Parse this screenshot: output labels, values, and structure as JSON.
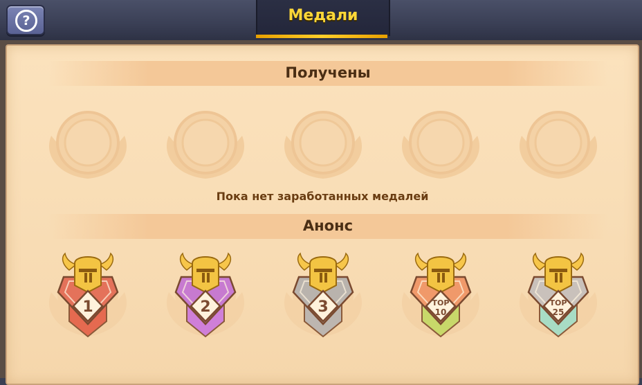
{
  "header": {
    "help_icon": "question-icon",
    "tab_title": "Медали"
  },
  "received": {
    "title": "Получены",
    "slot_count": 5,
    "empty_text": "Пока нет заработанных медалей"
  },
  "announce": {
    "title": "Анонс",
    "medals": [
      {
        "rank_line1": "1",
        "rank_line2": "",
        "color": "#e4725a",
        "ribbon": "#e56a50"
      },
      {
        "rank_line1": "2",
        "rank_line2": "",
        "color": "#c77ad0",
        "ribbon": "#cf7fd8"
      },
      {
        "rank_line1": "3",
        "rank_line2": "",
        "color": "#b9b3ad",
        "ribbon": "#bdb6b0"
      },
      {
        "rank_line1": "TOP",
        "rank_line2": "10",
        "color": "#f0996a",
        "ribbon": "#c8d86a"
      },
      {
        "rank_line1": "TOP",
        "rank_line2": "25",
        "color": "#c9c1bb",
        "ribbon": "#a8dcc4"
      }
    ]
  }
}
